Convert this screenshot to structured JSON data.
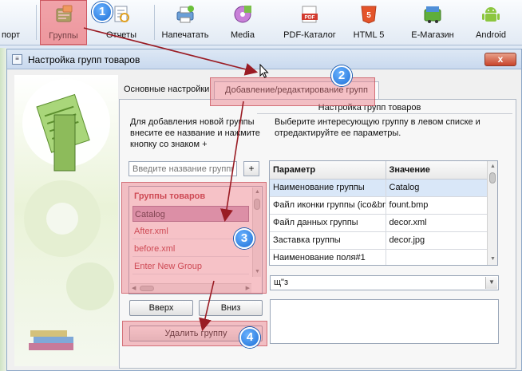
{
  "toolbar": {
    "items": [
      {
        "label": "порт",
        "icon": "export-icon"
      },
      {
        "label": "Группы",
        "icon": "groups-icon",
        "active": true
      },
      {
        "label": "Отчеты",
        "icon": "reports-icon"
      },
      {
        "label": "Напечатать",
        "icon": "print-icon"
      },
      {
        "label": "Media",
        "icon": "media-icon"
      },
      {
        "label": "PDF-Каталог",
        "icon": "pdf-icon"
      },
      {
        "label": "HTML 5",
        "icon": "html5-icon"
      },
      {
        "label": "E-Магазин",
        "icon": "eshop-icon"
      },
      {
        "label": "Android",
        "icon": "android-icon"
      }
    ]
  },
  "window": {
    "title": "Настройка групп товаров",
    "close": "x"
  },
  "tabs": {
    "basic": "Основные настройки",
    "edit": "Добавление/редактирование групп"
  },
  "panel": {
    "header": "Настройка групп товаров",
    "hint_left": [
      "Для добавления новой группы",
      "внесите ее название и нажмите",
      "кнопку со знаком +"
    ],
    "hint_right": [
      "Выберите интересующую группу в левом списке и",
      "отредактируйте ее параметры."
    ]
  },
  "group_input": {
    "placeholder": "Введите название группы",
    "add_label": "+"
  },
  "group_list": {
    "header": "Группы товаров",
    "items": [
      "Catalog",
      "After.xml",
      "before.xml",
      "Enter New Group"
    ],
    "selected": "Catalog"
  },
  "buttons": {
    "up": "Вверх",
    "down": "Вниз",
    "delete": "Удалить группу"
  },
  "params": {
    "col_param": "Параметр",
    "col_value": "Значение",
    "rows": [
      {
        "param": "Наименование группы",
        "value": "Catalog"
      },
      {
        "param": "Файл иконки группы (ico&bmp)",
        "value": "fount.bmp"
      },
      {
        "param": "Файл данных группы",
        "value": "decor.xml"
      },
      {
        "param": "Заставка группы",
        "value": "decor.jpg"
      },
      {
        "param": "Наименование поля#1",
        "value": ""
      }
    ]
  },
  "combo": {
    "value": "щ\"з"
  },
  "annotations": {
    "badges": [
      "1",
      "2",
      "3",
      "4"
    ],
    "highlight_color": "#eb7882",
    "arrow_color": "#9a1c24",
    "badge_color": "#1d6fd6"
  }
}
